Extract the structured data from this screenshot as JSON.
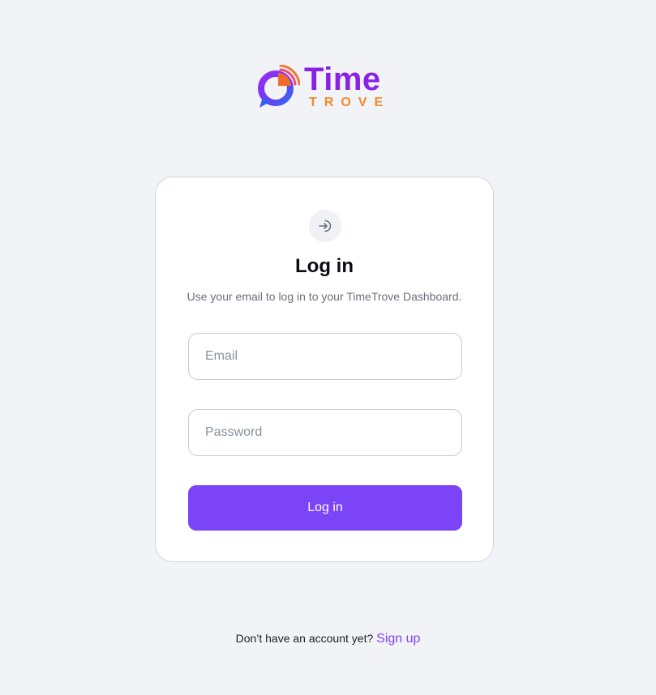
{
  "brand": {
    "name_primary": "Time",
    "name_secondary": "TROVE",
    "primary_color": "#8a22e6",
    "secondary_color": "#f08a2e"
  },
  "login_card": {
    "icon": "login-arrow-icon",
    "title": "Log in",
    "subtitle": "Use your email to log in to your TimeTrove Dashboard.",
    "email": {
      "value": "",
      "placeholder": "Email"
    },
    "password": {
      "value": "",
      "placeholder": "Password"
    },
    "submit_label": "Log in",
    "accent_color": "#7c44f7"
  },
  "footer": {
    "prompt": "Don’t have an account yet?",
    "signup_label": "Sign up"
  }
}
